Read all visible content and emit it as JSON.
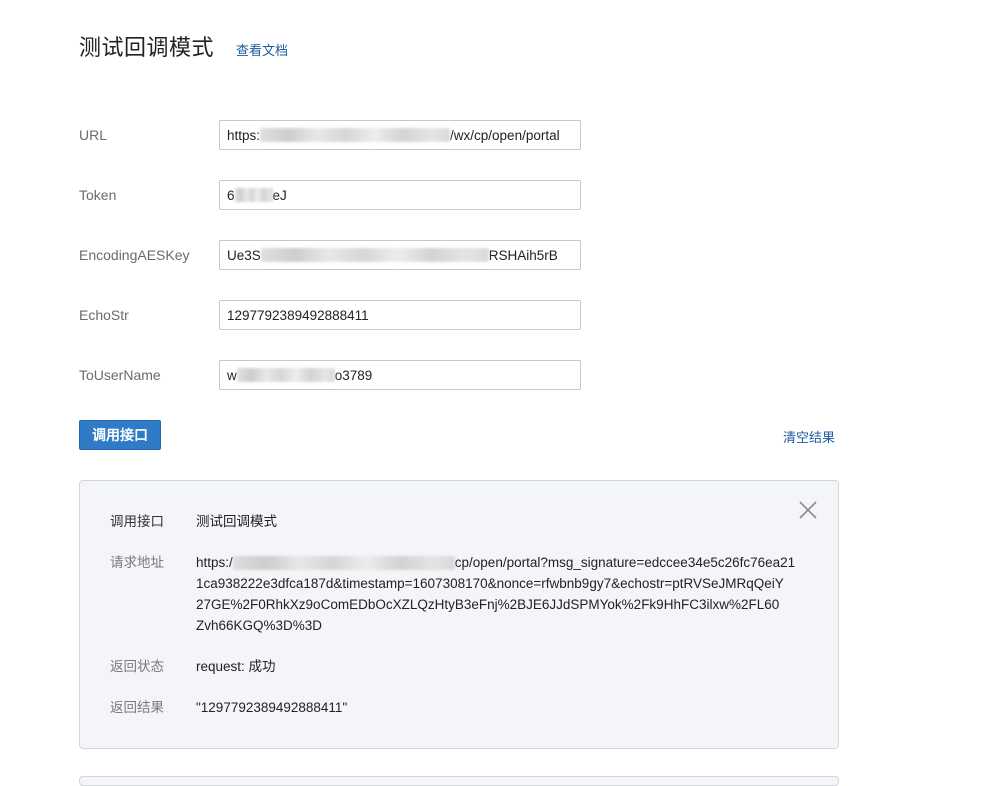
{
  "header": {
    "title": "测试回调模式",
    "doc_link": "查看文档"
  },
  "form": {
    "url": {
      "label": "URL",
      "value_prefix": "https:",
      "value_suffix": "/wx/cp/open/portal"
    },
    "token": {
      "label": "Token",
      "value_prefix": "6",
      "value_suffix": "eJ"
    },
    "aeskey": {
      "label": "EncodingAESKey",
      "value_prefix": "Ue3S",
      "value_suffix": "RSHAih5rB"
    },
    "echostr": {
      "label": "EchoStr",
      "value": "1297792389492888411"
    },
    "touser": {
      "label": "ToUserName",
      "value_prefix": "w",
      "value_suffix": "o3789"
    }
  },
  "actions": {
    "invoke_label": "调用接口",
    "clear_label": "清空结果"
  },
  "result": {
    "api_label": "调用接口",
    "api_value": "测试回调模式",
    "url_label": "请求地址",
    "url_prefix": "https:/",
    "url_rest": "cp/open/portal?msg_signature=edccee34e5c26fc76ea21",
    "url_line2": "1ca938222e3dfca187d&timestamp=1607308170&nonce=rfwbnb9gy7&echostr=ptRVSeJMRqQeiY",
    "url_line3": "27GE%2F0RhkXz9oComEDbOcXZLQzHtyB3eFnj%2BJE6JJdSPMYok%2Fk9HhFC3ilxw%2FL60",
    "url_line4": "Zvh66KGQ%3D%3D",
    "status_label": "返回状态",
    "status_value": "request: 成功",
    "body_label": "返回结果",
    "body_value": "\"1297792389492888411\""
  }
}
